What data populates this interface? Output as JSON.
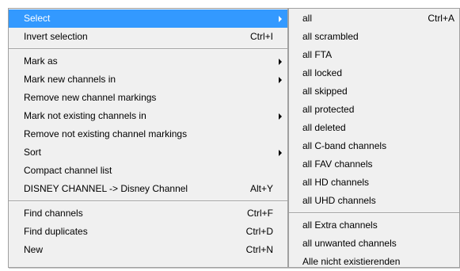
{
  "main_menu": {
    "items": [
      {
        "label": "Select",
        "shortcut": "",
        "submenu": true,
        "highlighted": true
      },
      {
        "label": "Invert selection",
        "shortcut": "Ctrl+I",
        "submenu": false
      },
      {
        "label": "Mark as",
        "shortcut": "",
        "submenu": true
      },
      {
        "label": "Mark new channels in",
        "shortcut": "",
        "submenu": true
      },
      {
        "label": "Remove new channel markings",
        "shortcut": "",
        "submenu": false
      },
      {
        "label": "Mark not existing channels in",
        "shortcut": "",
        "submenu": true
      },
      {
        "label": "Remove not existing channel markings",
        "shortcut": "",
        "submenu": false
      },
      {
        "label": "Sort",
        "shortcut": "",
        "submenu": true
      },
      {
        "label": "Compact channel list",
        "shortcut": "",
        "submenu": false
      },
      {
        "label": "DISNEY CHANNEL -> Disney Channel",
        "shortcut": "Alt+Y",
        "submenu": false
      },
      {
        "label": "Find channels",
        "shortcut": "Ctrl+F",
        "submenu": false
      },
      {
        "label": "Find duplicates",
        "shortcut": "Ctrl+D",
        "submenu": false
      },
      {
        "label": "New",
        "shortcut": "Ctrl+N",
        "submenu": false
      }
    ]
  },
  "select_submenu": {
    "items": [
      {
        "label": "all",
        "shortcut": "Ctrl+A"
      },
      {
        "label": "all scrambled",
        "shortcut": ""
      },
      {
        "label": "all FTA",
        "shortcut": ""
      },
      {
        "label": "all locked",
        "shortcut": ""
      },
      {
        "label": "all skipped",
        "shortcut": ""
      },
      {
        "label": "all protected",
        "shortcut": ""
      },
      {
        "label": "all deleted",
        "shortcut": ""
      },
      {
        "label": "all C-band channels",
        "shortcut": ""
      },
      {
        "label": "all FAV channels",
        "shortcut": ""
      },
      {
        "label": "all HD channels",
        "shortcut": ""
      },
      {
        "label": "all UHD channels",
        "shortcut": ""
      },
      {
        "label": "all Extra channels",
        "shortcut": ""
      },
      {
        "label": "all unwanted channels",
        "shortcut": ""
      },
      {
        "label": "Alle nicht existierenden",
        "shortcut": ""
      }
    ]
  },
  "colors": {
    "menu_background": "#f0f0f0",
    "highlight": "#3399ff",
    "separator": "#a0a0a0"
  }
}
